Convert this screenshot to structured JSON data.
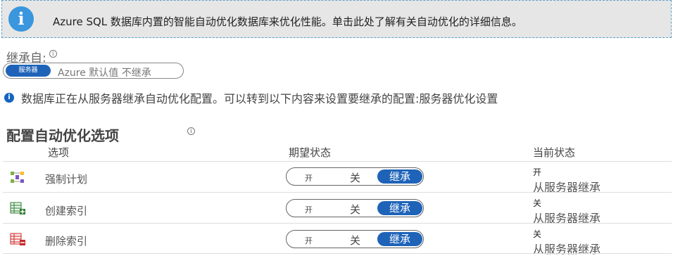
{
  "banner": {
    "icon": "info-icon",
    "text": "Azure SQL 数据库内置的智能自动优化数据库来优化性能。单击此处了解有关自动优化的详细信息。"
  },
  "inherit": {
    "label": "继承自:",
    "options": {
      "server": "服务器",
      "rest": "Azure 默认值  不继承"
    },
    "selected": "服务器"
  },
  "note": {
    "icon": "info-icon",
    "text": "数据库正在从服务器继承自动优化配置。可以转到以下内容来设置要继承的配置:服务器优化设置"
  },
  "section": {
    "title": "配置自动优化选项"
  },
  "table": {
    "headers": {
      "option": "选项",
      "desired": "期望状态",
      "current": "当前状态"
    },
    "toggle_labels": {
      "on": "开",
      "off": "关",
      "inherit": "继承"
    },
    "rows": [
      {
        "icon": "force-plan-icon",
        "label": "强制计划",
        "selected": "继承",
        "current_state": "开",
        "current_source": "从服务器继承"
      },
      {
        "icon": "create-index-icon",
        "label": "创建索引",
        "selected": "继承",
        "current_state": "关",
        "current_source": "从服务器继承"
      },
      {
        "icon": "drop-index-icon",
        "label": "删除索引",
        "selected": "继承",
        "current_state": "关",
        "current_source": "从服务器继承"
      }
    ]
  },
  "colors": {
    "accent": "#1e63b8",
    "info": "#3a96dd",
    "banner_bg": "#e6e6e6"
  }
}
